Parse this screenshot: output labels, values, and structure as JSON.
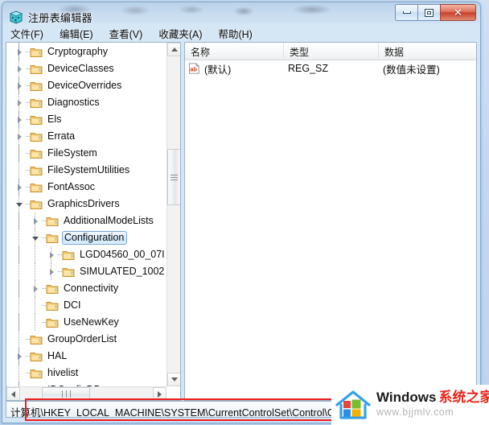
{
  "window": {
    "title": "注册表编辑器",
    "icon": "regedit-icon",
    "buttons": {
      "minimize": "minimize-button",
      "maximize": "maximize-button",
      "close": "close-button",
      "close_glyph": "✕"
    }
  },
  "menu": {
    "items": [
      {
        "label": "文件(F)"
      },
      {
        "label": "编辑(E)"
      },
      {
        "label": "查看(V)"
      },
      {
        "label": "收藏夹(A)"
      },
      {
        "label": "帮助(H)"
      }
    ]
  },
  "tree": {
    "rows": [
      {
        "label": "Cryptography",
        "depth": 1,
        "state": "collapsed",
        "selected": false
      },
      {
        "label": "DeviceClasses",
        "depth": 1,
        "state": "collapsed",
        "selected": false
      },
      {
        "label": "DeviceOverrides",
        "depth": 1,
        "state": "collapsed",
        "selected": false
      },
      {
        "label": "Diagnostics",
        "depth": 1,
        "state": "collapsed",
        "selected": false
      },
      {
        "label": "Els",
        "depth": 1,
        "state": "collapsed",
        "selected": false
      },
      {
        "label": "Errata",
        "depth": 1,
        "state": "collapsed",
        "selected": false
      },
      {
        "label": "FileSystem",
        "depth": 1,
        "state": "leaf",
        "selected": false
      },
      {
        "label": "FileSystemUtilities",
        "depth": 1,
        "state": "leaf",
        "selected": false
      },
      {
        "label": "FontAssoc",
        "depth": 1,
        "state": "collapsed",
        "selected": false
      },
      {
        "label": "GraphicsDrivers",
        "depth": 1,
        "state": "expanded",
        "selected": false
      },
      {
        "label": "AdditionalModeLists",
        "depth": 2,
        "state": "collapsed",
        "selected": false
      },
      {
        "label": "Configuration",
        "depth": 2,
        "state": "expanded",
        "selected": true
      },
      {
        "label": "LGD04560_00_07I",
        "depth": 3,
        "state": "collapsed",
        "selected": false
      },
      {
        "label": "SIMULATED_1002",
        "depth": 3,
        "state": "collapsed",
        "selected": false
      },
      {
        "label": "Connectivity",
        "depth": 2,
        "state": "collapsed",
        "selected": false
      },
      {
        "label": "DCI",
        "depth": 2,
        "state": "leaf",
        "selected": false
      },
      {
        "label": "UseNewKey",
        "depth": 2,
        "state": "leaf",
        "selected": false
      },
      {
        "label": "GroupOrderList",
        "depth": 1,
        "state": "leaf",
        "selected": false
      },
      {
        "label": "HAL",
        "depth": 1,
        "state": "collapsed",
        "selected": false
      },
      {
        "label": "hivelist",
        "depth": 1,
        "state": "leaf",
        "selected": false
      },
      {
        "label": "IDConfigDB",
        "depth": 1,
        "state": "collapsed",
        "selected": false
      }
    ],
    "scrollbars": {
      "vertical": "tree-vertical-scrollbar",
      "horizontal": "tree-horizontal-scrollbar"
    }
  },
  "list": {
    "columns": [
      "名称",
      "类型",
      "数据"
    ],
    "rows": [
      {
        "icon": "string-value-icon",
        "name": "(默认)",
        "type": "REG_SZ",
        "data": "(数值未设置)"
      }
    ]
  },
  "statusbar": {
    "path": "计算机\\HKEY_LOCAL_MACHINE\\SYSTEM\\CurrentControlSet\\Control\\G"
  },
  "watermark": {
    "brand_en": "Windows",
    "brand_cn": "系统之家",
    "url": "www.bjjmlv.com",
    "logo": "windows-house-logo"
  },
  "colors": {
    "accent": "#7ba7d6",
    "annotation": "#ef1c1c",
    "brand_red": "#e8261c",
    "folder": "#ffd27f"
  }
}
